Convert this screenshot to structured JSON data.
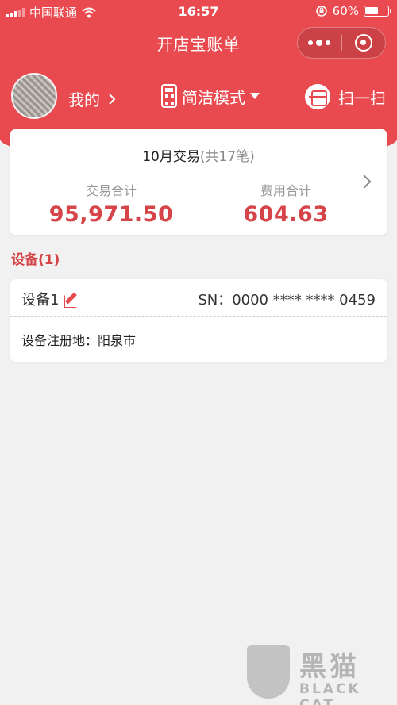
{
  "status_bar": {
    "carrier": "中国联通",
    "time": "16:57",
    "battery": "60%",
    "battery_level": 0.6
  },
  "nav": {
    "title": "开店宝账单"
  },
  "toolbar": {
    "mine_label": "我的",
    "mode_label": "简洁模式",
    "scan_label": "扫一扫"
  },
  "transactions": {
    "month_title": "10月交易",
    "count_text": "(共17笔)",
    "total_label": "交易合计",
    "total_value": "95,971.50",
    "fee_label": "费用合计",
    "fee_value": "604.63"
  },
  "devices": {
    "section_title": "设备(1)",
    "items": [
      {
        "name": "设备1",
        "sn": "SN：0000 **** **** 0459",
        "registration": "设备注册地：阳泉市"
      }
    ]
  },
  "watermark": {
    "big": "黑猫",
    "small": "BLACK CAT"
  },
  "colors": {
    "primary_red": "#e84a4f",
    "value_red": "#d54448",
    "background": "#f1f1f1"
  }
}
